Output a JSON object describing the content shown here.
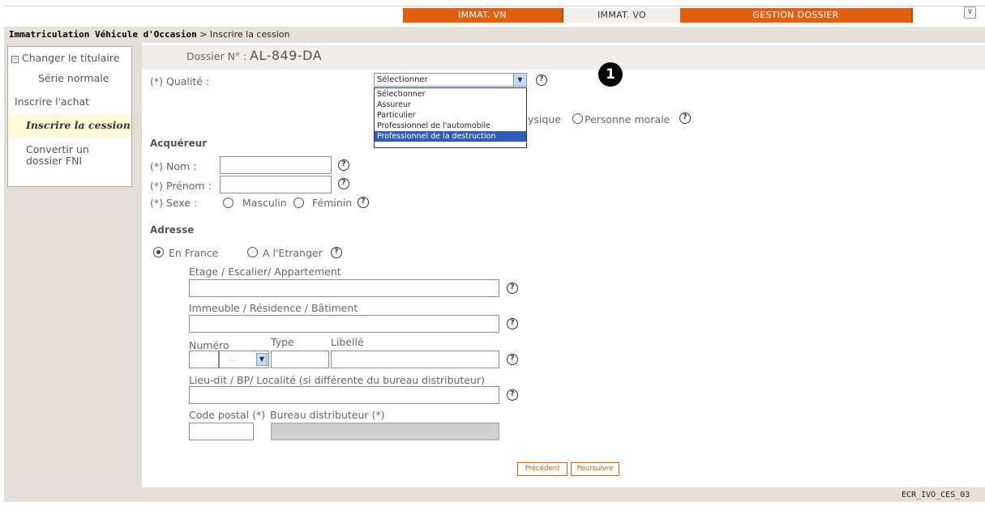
{
  "tabs": [
    {
      "label": "IMMAT. VN"
    },
    {
      "label": "IMMAT. VO"
    },
    {
      "label": "GESTION DOSSIER"
    }
  ],
  "breadcrumb": {
    "section": "Immatriculation Véhicule d'Occasion",
    "separator": ">",
    "page": "Inscrire la cession"
  },
  "sidebar": {
    "items": [
      {
        "label": "Changer le titulaire"
      },
      {
        "label": "Série normale"
      },
      {
        "label": "Inscrire l'achat"
      },
      {
        "label": "Inscrire la cession"
      },
      {
        "label": "Convertir un"
      },
      {
        "label": "dossier FNI"
      }
    ]
  },
  "dossier": {
    "label": "Dossier N° :",
    "number": "AL-849-DA"
  },
  "qualite": {
    "label": "(*) Qualité :",
    "selected": "Sélectionner",
    "options": [
      "Sélectionner",
      "Assureur",
      "Particulier",
      "Professionnel de l'automobile",
      "Professionnel de la destruction"
    ],
    "highlighted_index": 4
  },
  "personne": {
    "physique_partial": "ysique",
    "morale": "Personne morale"
  },
  "acquereur": {
    "title": "Acquéreur",
    "nom": "(*) Nom :",
    "prenom": "(*) Prénom :",
    "sexe": "(*) Sexe :",
    "masculin": "Masculin",
    "feminin": "Féminin"
  },
  "adresse": {
    "title": "Adresse",
    "en_france": "En France",
    "etranger": "A l'Etranger",
    "etage": "Etage / Escalier/ Appartement",
    "immeuble": "Immeuble / Résidence / Bâtiment",
    "numero": "Numéro",
    "type": "Type",
    "libelle": "Libellé",
    "type_select": "...",
    "lieudit": "Lieu-dit / BP/ Localité (si différente du bureau distributeur)",
    "code_postal": "Code postal (*)",
    "bureau": "Bureau distributeur (*)"
  },
  "help_glyph": "?",
  "callout": "1",
  "buttons": {
    "precedent": "Précédent",
    "poursuivre": "Poursuivre"
  },
  "footer": {
    "code": "ECR_IVO_CES_03"
  },
  "colors": {
    "accent": "#e06010",
    "sidebar_highlight": "#fffad8",
    "selection": "#2e5cb8"
  }
}
